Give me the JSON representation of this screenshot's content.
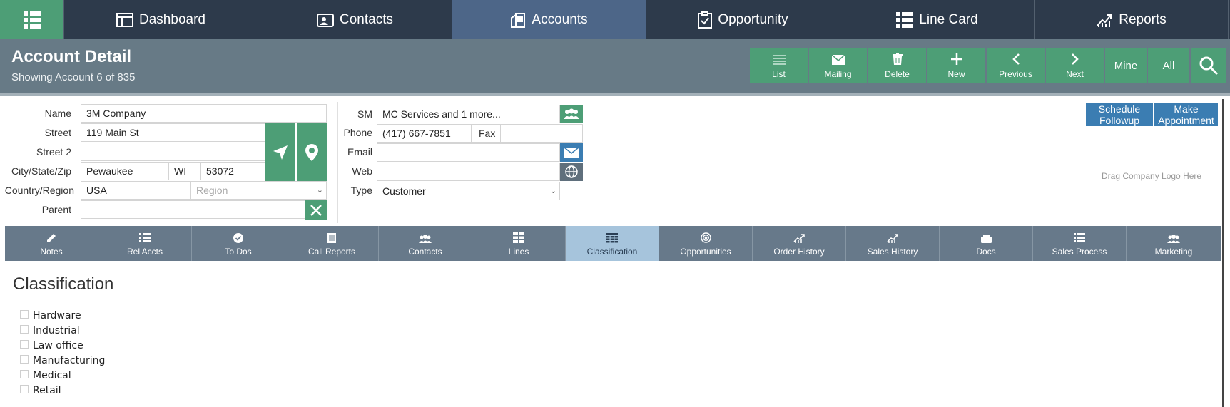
{
  "nav": {
    "tabs": [
      {
        "label": "Dashboard",
        "icon": "dashboard-icon"
      },
      {
        "label": "Contacts",
        "icon": "contacts-icon"
      },
      {
        "label": "Accounts",
        "icon": "building-icon",
        "active": true
      },
      {
        "label": "Opportunity",
        "icon": "clipboard-icon"
      },
      {
        "label": "Line Card",
        "icon": "grid-icon"
      },
      {
        "label": "Reports",
        "icon": "chart-icon"
      }
    ]
  },
  "header": {
    "title": "Account Detail",
    "subtitle": "Showing Account 6 of 835",
    "toolbar": {
      "list": "List",
      "mailing": "Mailing",
      "delete": "Delete",
      "new": "New",
      "previous": "Previous",
      "next": "Next",
      "mine": "Mine",
      "all": "All"
    }
  },
  "form": {
    "labels": {
      "name": "Name",
      "street": "Street",
      "street2": "Street 2",
      "city_state_zip": "City/State/Zip",
      "country_region": "Country/Region",
      "parent": "Parent",
      "sm": "SM",
      "phone": "Phone",
      "fax": "Fax",
      "email": "Email",
      "web": "Web",
      "type": "Type"
    },
    "values": {
      "name": "3M Company",
      "street": "119 Main St",
      "street2": "",
      "city": "Pewaukee",
      "state": "WI",
      "zip": "53072",
      "country": "USA",
      "region_placeholder": "Region",
      "parent": "",
      "sm": "MC Services and 1 more...",
      "phone": "(417) 667-7851",
      "fax": "",
      "email": "",
      "web": "",
      "type": "Customer"
    },
    "actions": {
      "schedule_followup": "Schedule Followup",
      "make_appointment": "Make Appointment"
    },
    "logo_drop": "Drag Company Logo Here"
  },
  "tabs": [
    {
      "label": "Notes",
      "icon": "pencil-icon"
    },
    {
      "label": "Rel Accts",
      "icon": "list-icon"
    },
    {
      "label": "To Dos",
      "icon": "check-circle-icon"
    },
    {
      "label": "Call Reports",
      "icon": "document-icon"
    },
    {
      "label": "Contacts",
      "icon": "people-icon"
    },
    {
      "label": "Lines",
      "icon": "grid-icon"
    },
    {
      "label": "Classification",
      "icon": "table-icon",
      "active": true
    },
    {
      "label": "Opportunities",
      "icon": "target-icon"
    },
    {
      "label": "Order History",
      "icon": "chart-icon"
    },
    {
      "label": "Sales History",
      "icon": "chart-icon"
    },
    {
      "label": "Docs",
      "icon": "folder-icon"
    },
    {
      "label": "Sales Process",
      "icon": "list-icon"
    },
    {
      "label": "Marketing",
      "icon": "people-icon"
    }
  ],
  "classification": {
    "title": "Classification",
    "items": [
      {
        "label": "Hardware",
        "checked": false
      },
      {
        "label": "Industrial",
        "checked": false
      },
      {
        "label": "Law office",
        "checked": false
      },
      {
        "label": "Manufacturing",
        "checked": false
      },
      {
        "label": "Medical",
        "checked": false
      },
      {
        "label": "Retail",
        "checked": false
      }
    ]
  },
  "colors": {
    "nav_bg": "#2d3a4b",
    "nav_active": "#4d6688",
    "accent_green": "#4d9e76",
    "header_bg": "#677a86",
    "tab_bar": "#67798a",
    "tab_active": "#a6c4dc",
    "action_blue": "#3b7db2"
  }
}
